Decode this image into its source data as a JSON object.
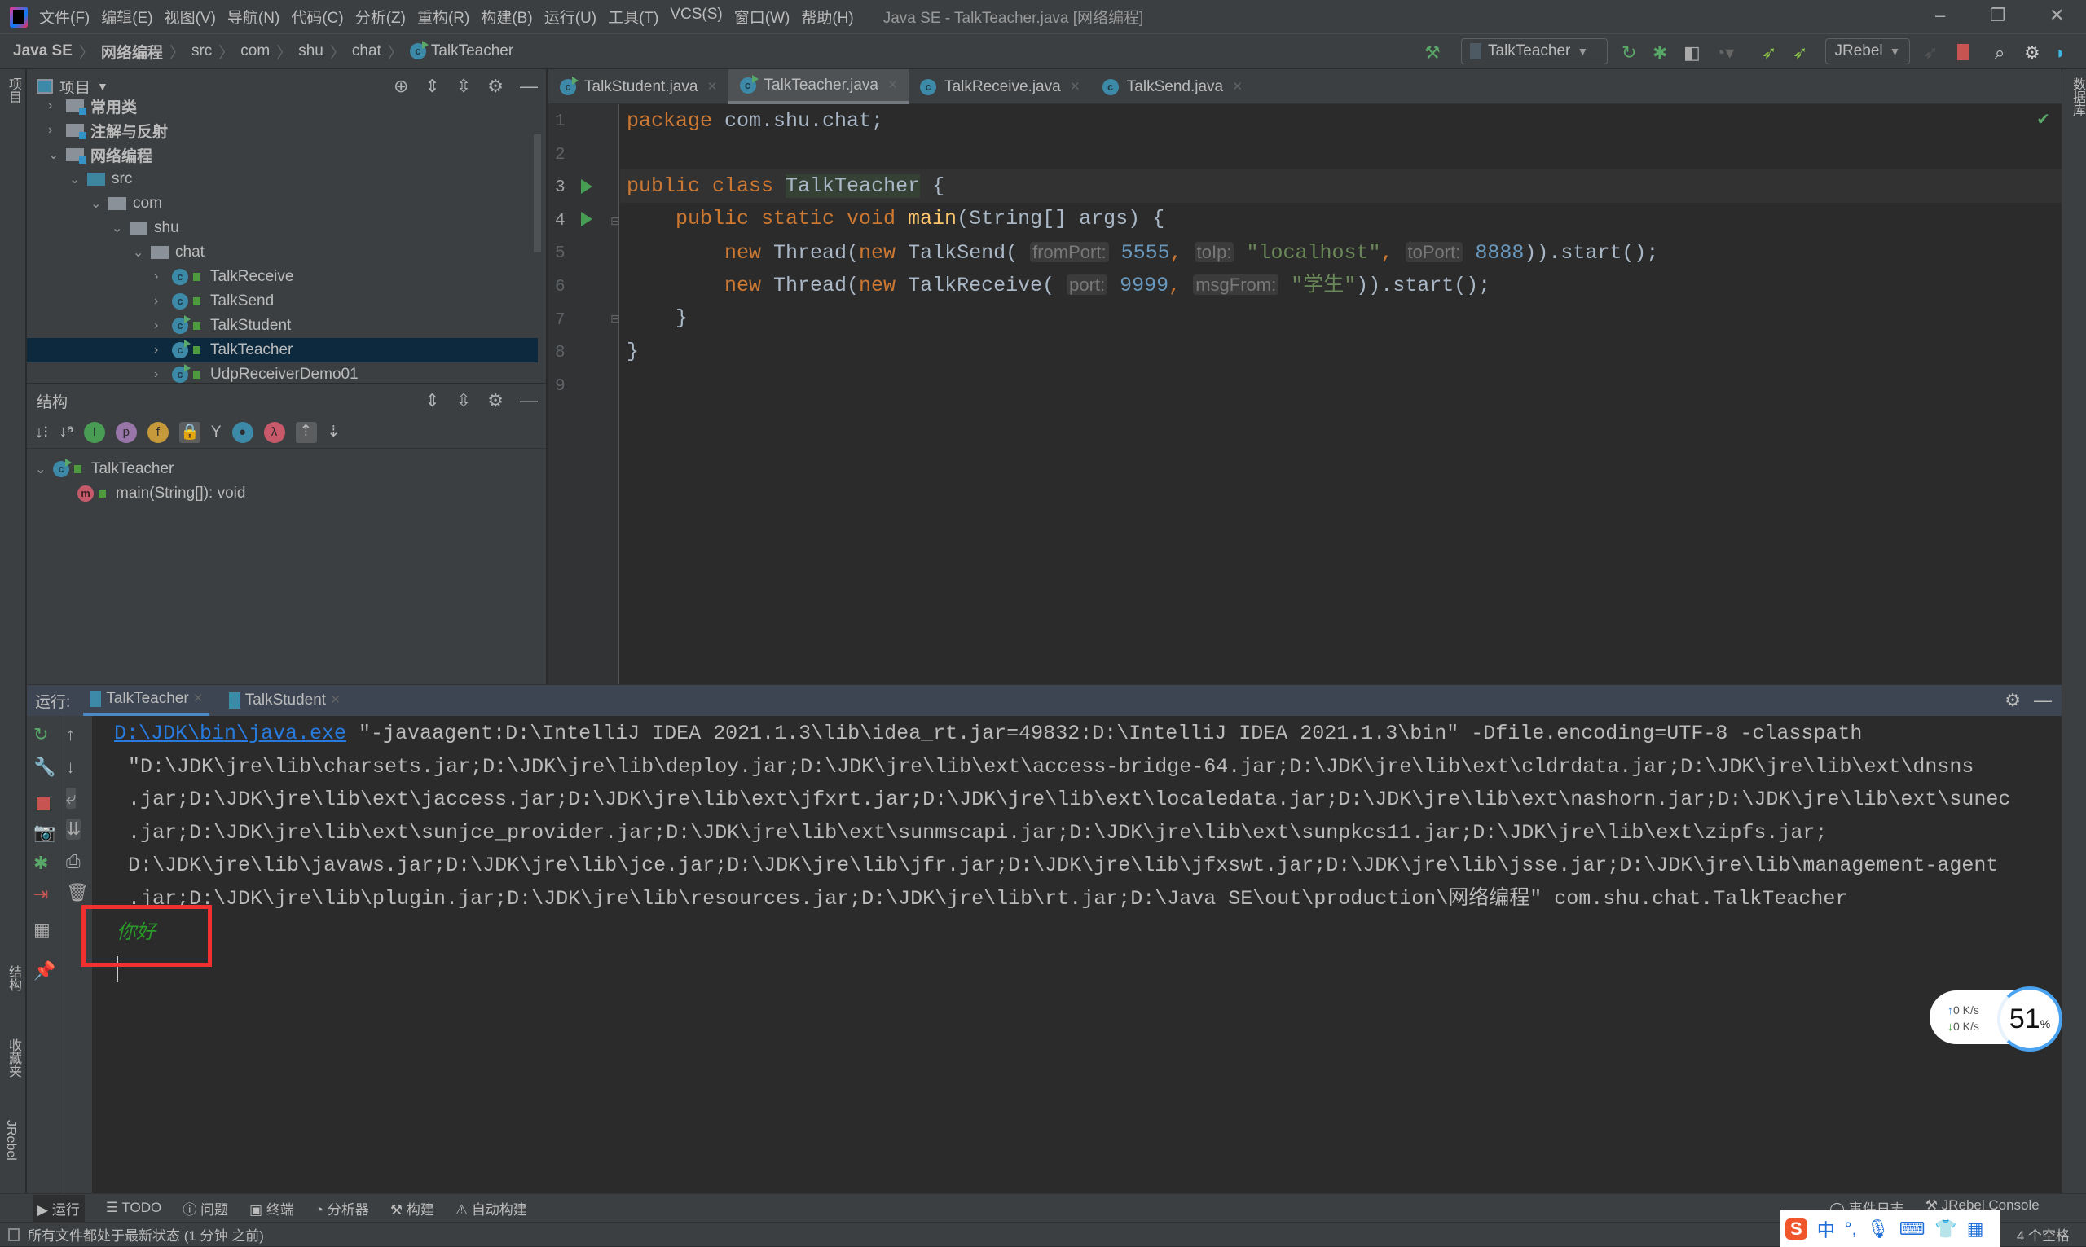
{
  "menu": [
    "文件(F)",
    "编辑(E)",
    "视图(V)",
    "导航(N)",
    "代码(C)",
    "分析(Z)",
    "重构(R)",
    "构建(B)",
    "运行(U)",
    "工具(T)",
    "VCS(S)",
    "窗口(W)",
    "帮助(H)"
  ],
  "window_title": "Java SE - TalkTeacher.java [网络编程]",
  "breadcrumb": [
    "Java SE",
    "网络编程",
    "src",
    "com",
    "shu",
    "chat",
    "TalkTeacher"
  ],
  "toolbar": {
    "run_config": "TalkTeacher",
    "jrebel": "JRebel"
  },
  "project": {
    "title": "项目",
    "tree": [
      {
        "label": "常用类",
        "level": 1,
        "type": "module",
        "chev": ">"
      },
      {
        "label": "注解与反射",
        "level": 1,
        "type": "module",
        "chev": ">"
      },
      {
        "label": "网络编程",
        "level": 1,
        "type": "module",
        "chev": "v"
      },
      {
        "label": "src",
        "level": 2,
        "type": "src",
        "chev": "v"
      },
      {
        "label": "com",
        "level": 3,
        "type": "pkg",
        "chev": "v"
      },
      {
        "label": "shu",
        "level": 4,
        "type": "pkg",
        "chev": "v"
      },
      {
        "label": "chat",
        "level": 5,
        "type": "pkg",
        "chev": "v"
      },
      {
        "label": "TalkReceive",
        "level": 6,
        "type": "class",
        "chev": ">"
      },
      {
        "label": "TalkSend",
        "level": 6,
        "type": "class",
        "chev": ">"
      },
      {
        "label": "TalkStudent",
        "level": 6,
        "type": "runclass",
        "chev": ">"
      },
      {
        "label": "TalkTeacher",
        "level": 6,
        "type": "runclass",
        "chev": ">",
        "selected": true
      },
      {
        "label": "UdpReceiverDemo01",
        "level": 6,
        "type": "runclass",
        "chev": ">"
      }
    ]
  },
  "structure": {
    "title": "结构",
    "class": "TalkTeacher",
    "method": "main(String[]): void"
  },
  "editor": {
    "tabs": [
      {
        "label": "TalkStudent.java",
        "active": false
      },
      {
        "label": "TalkTeacher.java",
        "active": true
      },
      {
        "label": "TalkReceive.java",
        "active": false
      },
      {
        "label": "TalkSend.java",
        "active": false
      }
    ],
    "line_numbers": [
      "1",
      "2",
      "3",
      "4",
      "5",
      "6",
      "7",
      "8",
      "9"
    ],
    "code": {
      "l1_kw": "package",
      "l1_rest": " com.shu.chat;",
      "l3_kw": "public class ",
      "l3_cls": "TalkTeacher",
      "l3_rest": " {",
      "l4_kw": "public static void ",
      "l4_fn": "main",
      "l4_rest": "(String[] args) {",
      "l5_a": "new ",
      "l5_b": "Thread(",
      "l5_c": "new ",
      "l5_d": "TalkSend(",
      "l5_h1": "fromPort:",
      "l5_v1": "5555",
      ", ": ", ",
      "l5_h2": "toIp:",
      "l5_v2": "\"localhost\"",
      "l5_h3": "toPort:",
      "l5_v3": "8888",
      "l5_end": ")).start();",
      "l6_a": "new ",
      "l6_b": "Thread(",
      "l6_c": "new ",
      "l6_d": "TalkReceive(",
      "l6_h1": "port:",
      "l6_v1": "9999",
      "l6_h2": "msgFrom:",
      "l6_v2": "\"学生\"",
      "l6_end": ")).start();",
      "comma": ", ",
      "l7": "}",
      "l8": "}"
    }
  },
  "run": {
    "label": "运行:",
    "tabs": [
      "TalkTeacher",
      "TalkStudent"
    ],
    "cmd_link": "D:\\JDK\\bin\\java.exe",
    "lines": [
      " \"-javaagent:D:\\IntelliJ IDEA 2021.1.3\\lib\\idea_rt.jar=49832:D:\\IntelliJ IDEA 2021.1.3\\bin\" -Dfile.encoding=UTF-8 -classpath",
      "\"D:\\JDK\\jre\\lib\\charsets.jar;D:\\JDK\\jre\\lib\\deploy.jar;D:\\JDK\\jre\\lib\\ext\\access-bridge-64.jar;D:\\JDK\\jre\\lib\\ext\\cldrdata.jar;D:\\JDK\\jre\\lib\\ext\\dnsns",
      ".jar;D:\\JDK\\jre\\lib\\ext\\jaccess.jar;D:\\JDK\\jre\\lib\\ext\\jfxrt.jar;D:\\JDK\\jre\\lib\\ext\\localedata.jar;D:\\JDK\\jre\\lib\\ext\\nashorn.jar;D:\\JDK\\jre\\lib\\ext\\sunec",
      ".jar;D:\\JDK\\jre\\lib\\ext\\sunjce_provider.jar;D:\\JDK\\jre\\lib\\ext\\sunmscapi.jar;D:\\JDK\\jre\\lib\\ext\\sunpkcs11.jar;D:\\JDK\\jre\\lib\\ext\\zipfs.jar;",
      "D:\\JDK\\jre\\lib\\javaws.jar;D:\\JDK\\jre\\lib\\jce.jar;D:\\JDK\\jre\\lib\\jfr.jar;D:\\JDK\\jre\\lib\\jfxswt.jar;D:\\JDK\\jre\\lib\\jsse.jar;D:\\JDK\\jre\\lib\\management-agent",
      ".jar;D:\\JDK\\jre\\lib\\plugin.jar;D:\\JDK\\jre\\lib\\resources.jar;D:\\JDK\\jre\\lib\\rt.jar;D:\\Java SE\\out\\production\\网络编程\" com.shu.chat.TalkTeacher"
    ],
    "output": "你好"
  },
  "net_widget": {
    "up": "0 K/s",
    "down": "0 K/s",
    "percent": "51",
    "unit": "%"
  },
  "bottom_tools": [
    "运行",
    "TODO",
    "问题",
    "终端",
    "分析器",
    "构建",
    "自动构建"
  ],
  "bottom_right": [
    "事件日志",
    "JRebel Console"
  ],
  "status": {
    "text": "所有文件都处于最新状态 (1 分钟 之前)",
    "right": "4 个空格"
  },
  "side_labels": {
    "project": "项目",
    "structure": "结构",
    "favorites": "收藏夹",
    "jrebel": "JRebel",
    "database": "数据库"
  },
  "colors": {
    "highlight_box": "#f23030",
    "output_green": "#2a9a2a",
    "link": "#287bde"
  }
}
